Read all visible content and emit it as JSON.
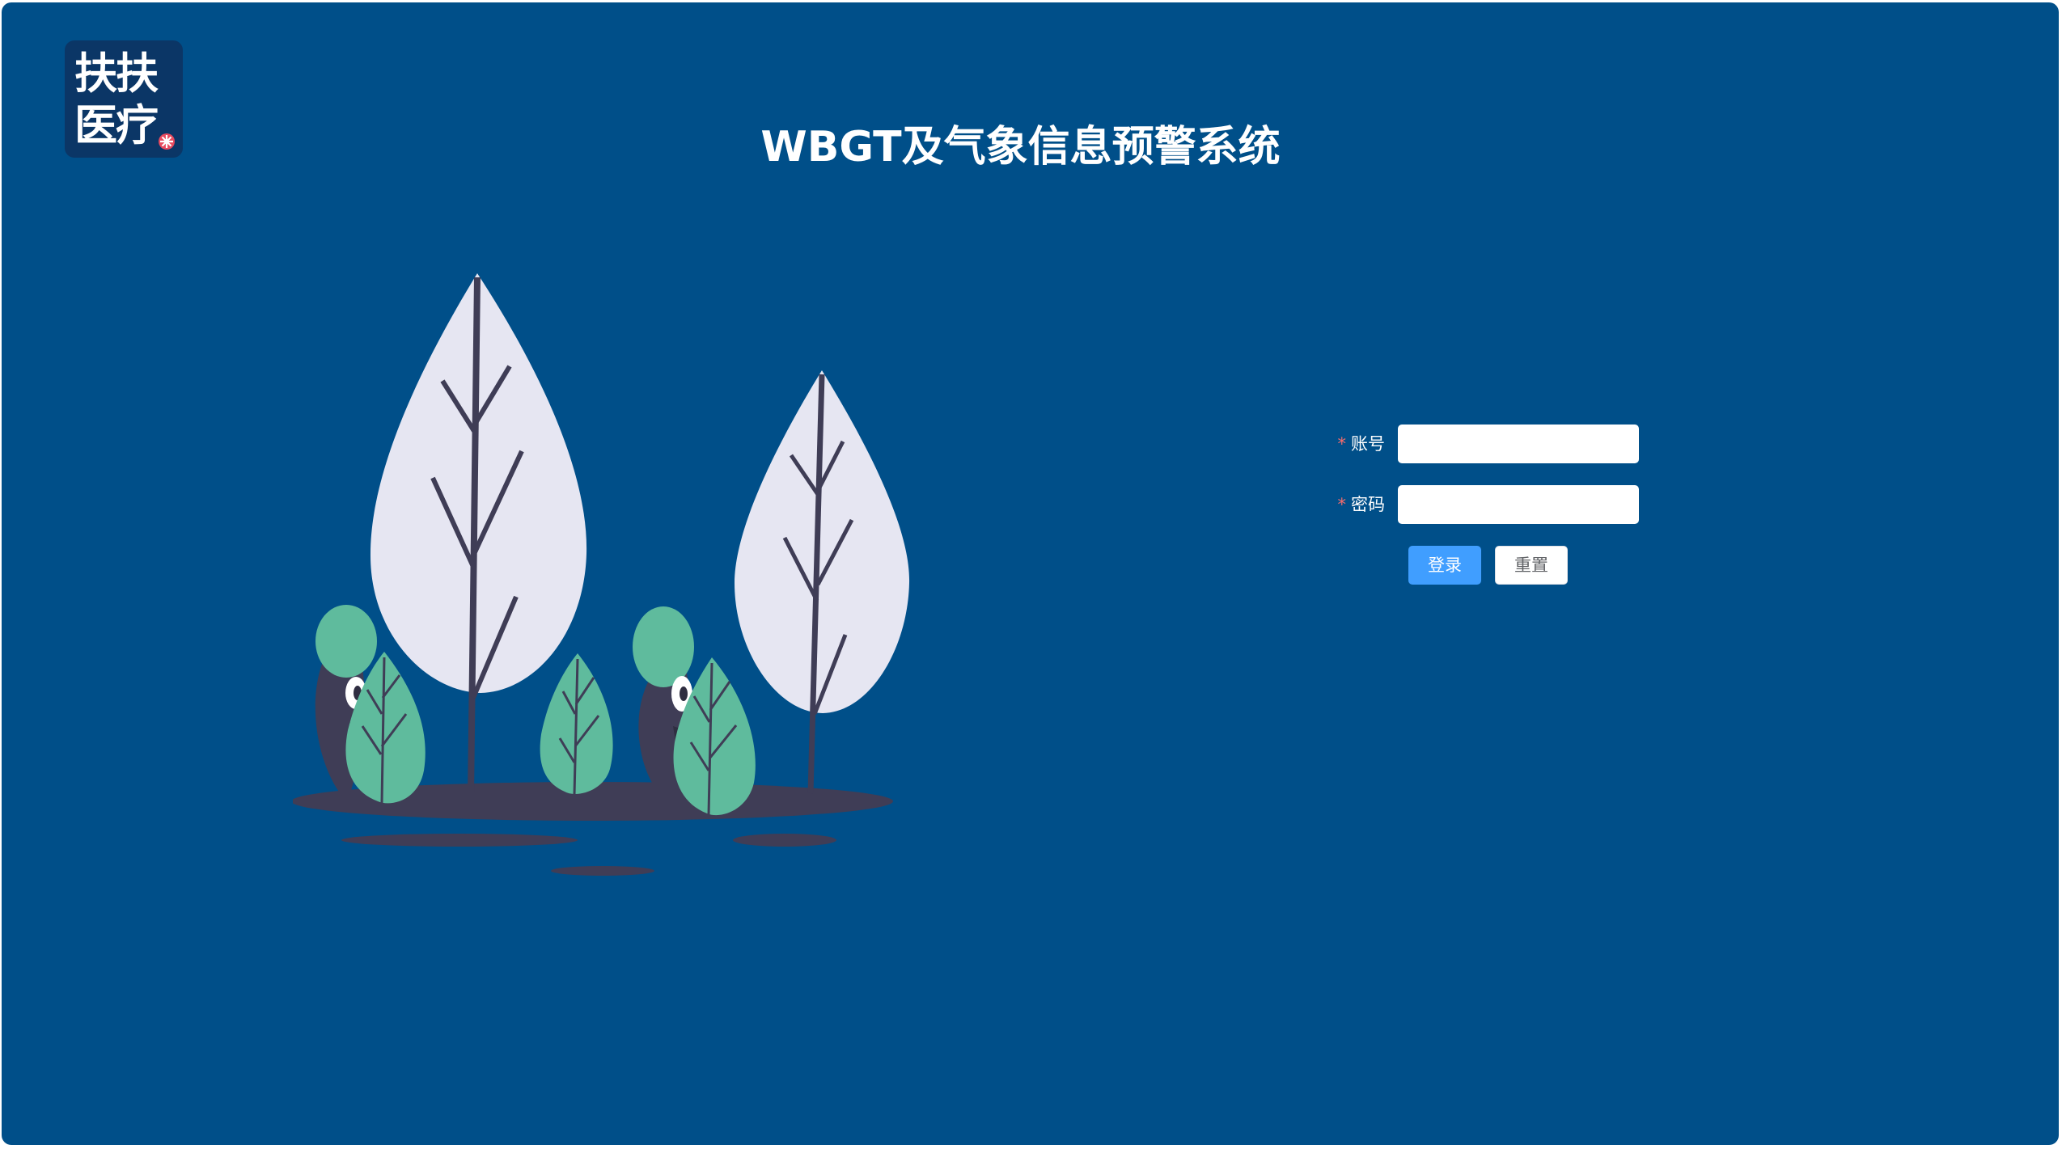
{
  "logo": {
    "line1": "扶扶",
    "line2": "医疗"
  },
  "page": {
    "title": "WBGT及气象信息预警系统"
  },
  "login": {
    "account_label": "账号",
    "password_label": "密码",
    "required_mark": "*",
    "account_value": "",
    "password_value": "",
    "login_button": "登录",
    "reset_button": "重置"
  },
  "colors": {
    "background": "#004f89",
    "primary_button": "#409eff",
    "required_mark": "#f56c6c",
    "leaf_light": "#e6e6f2",
    "leaf_green": "#5fbb9d",
    "trunk_dark": "#3f3d56"
  },
  "illustration": {
    "name": "trees-with-hiding-birds"
  }
}
